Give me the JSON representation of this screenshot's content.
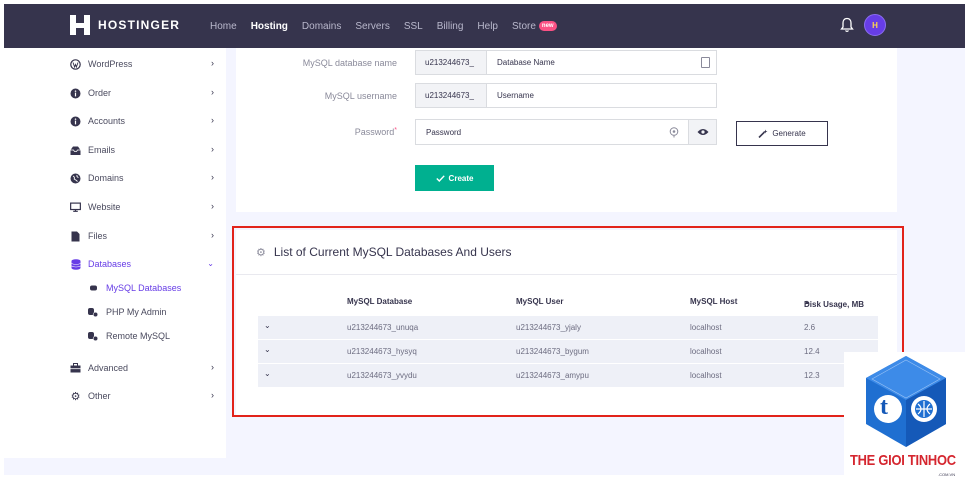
{
  "brand": {
    "name": "HOSTINGER"
  },
  "nav": {
    "links": [
      {
        "label": "Home"
      },
      {
        "label": "Hosting",
        "active": true
      },
      {
        "label": "Domains"
      },
      {
        "label": "Servers"
      },
      {
        "label": "SSL"
      },
      {
        "label": "Billing"
      },
      {
        "label": "Help"
      },
      {
        "label": "Store"
      }
    ],
    "store_badge": "new",
    "avatar_initial": "H"
  },
  "sidebar": {
    "items": [
      {
        "label": "WordPress",
        "icon": "wordpress-icon"
      },
      {
        "label": "Order",
        "icon": "info-icon"
      },
      {
        "label": "Accounts",
        "icon": "info-icon"
      },
      {
        "label": "Emails",
        "icon": "inbox-icon"
      },
      {
        "label": "Domains",
        "icon": "globe-icon"
      },
      {
        "label": "Website",
        "icon": "monitor-icon"
      },
      {
        "label": "Files",
        "icon": "file-icon"
      },
      {
        "label": "Databases",
        "icon": "database-icon",
        "active": true,
        "expanded": true
      },
      {
        "label": "Advanced",
        "icon": "briefcase-icon"
      },
      {
        "label": "Other",
        "icon": "gears-icon"
      }
    ],
    "subitems": [
      {
        "label": "MySQL Databases",
        "active": true
      },
      {
        "label": "PHP My Admin"
      },
      {
        "label": "Remote MySQL"
      }
    ]
  },
  "form": {
    "db_name_label": "MySQL database name",
    "db_prefix": "u213244673_",
    "db_placeholder": "Database Name",
    "user_label": "MySQL username",
    "user_prefix": "u213244673_",
    "user_placeholder": "Username",
    "password_label": "Password",
    "password_required": "*",
    "password_placeholder": "Password",
    "generate_label": "Generate",
    "create_label": "Create"
  },
  "list": {
    "title": "List of Current MySQL Databases And Users",
    "columns": [
      "MySQL Database",
      "MySQL User",
      "MySQL Host",
      "Disk Usage, MB"
    ],
    "sort_indicator": "▲",
    "rows": [
      {
        "database": "u213244673_unuqa",
        "user": "u213244673_yjaly",
        "host": "localhost",
        "disk": "2.6"
      },
      {
        "database": "u213244673_hysyq",
        "user": "u213244673_bygum",
        "host": "localhost",
        "disk": "12.4"
      },
      {
        "database": "u213244673_yvydu",
        "user": "u213244673_amypu",
        "host": "localhost",
        "disk": "12.3"
      }
    ]
  },
  "watermark": {
    "text": "THE GIOI TINHOC",
    "sub": ".COM.VN",
    "letter": "t"
  },
  "colors": {
    "nav_bg": "#36344d",
    "accent": "#673de6",
    "create_btn": "#00b090",
    "highlight": "#e2231a",
    "badge": "#fc5185"
  }
}
